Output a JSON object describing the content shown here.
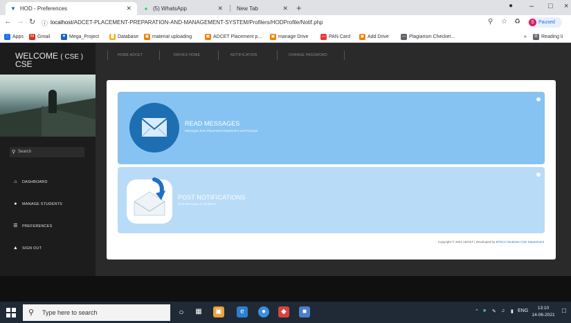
{
  "browser": {
    "tabs": [
      {
        "label": "HOD - Preferences",
        "icon": "site-favicon"
      },
      {
        "label": "(5) WhatsApp",
        "icon": "whatsapp-icon"
      },
      {
        "label": "New Tab",
        "icon": ""
      }
    ],
    "new_tab_label": "+",
    "window_controls": {
      "minimize": "–",
      "maximize": "□",
      "close": "×"
    },
    "address": {
      "host": "localhost",
      "path": "/ADCET-PLACEMENT-PREPARATION-AND-MANAGEMENT-SYSTEM/Profilers/HODProfile/Notif.php"
    },
    "profile_status": "Paused",
    "profile_initial": "S",
    "bookmarks": [
      {
        "label": "Apps",
        "color": "#1a73e8"
      },
      {
        "label": "Gmail",
        "color": "#d93025"
      },
      {
        "label": "Mega_Project",
        "color": "#1565c0"
      },
      {
        "label": "Database",
        "color": "#f9ab00"
      },
      {
        "label": "material uploading",
        "color": "#f57c00"
      },
      {
        "label": "ADCET Placement p...",
        "color": "#f57c00"
      },
      {
        "label": "manage Drive",
        "color": "#f57c00"
      },
      {
        "label": "PAN Card",
        "color": "#e53935"
      },
      {
        "label": "Add Drive",
        "color": "#f57c00"
      },
      {
        "label": "Plagiarism Checker...",
        "color": "#5f6368"
      }
    ],
    "bookmarks_overflow": "»",
    "reading_list_label": "Reading li"
  },
  "sidebar": {
    "welcome_title": "WELCOME",
    "welcome_dept": "( CSE )",
    "welcome_sub": "CSE",
    "search_placeholder": "Search",
    "items": [
      {
        "label": "DASHBOARD",
        "icon": "home-icon"
      },
      {
        "label": "MANAGE STUDENTS",
        "icon": "user-icon"
      },
      {
        "label": "PREFERENCES",
        "icon": "list-icon"
      },
      {
        "label": "SIGN OUT",
        "icon": "arrow-up-icon"
      }
    ]
  },
  "topnav": {
    "items": [
      "HOME ADCET",
      "DRIVES HOME",
      "NOTIFICATION",
      "CHANGE PASSWORD"
    ]
  },
  "cards": [
    {
      "title": "READ MESSAGES",
      "subtitle": "Messages from Placement Department and Principal",
      "icon": "envelope-icon",
      "color": "#86c3f2"
    },
    {
      "title": "POST NOTIFICATIONS",
      "subtitle": "Post Messages to Students",
      "icon": "send-mail-icon",
      "color": "#b8dbf7"
    }
  ],
  "footer": {
    "copyright_prefix": "Copyright © 2021 ADCET | Developed by ",
    "copyright_link": "BTECH Students CSE Department"
  },
  "taskbar": {
    "search_placeholder": "Type here to search",
    "tray_language": "ENG",
    "time": "13:10",
    "date": "14-06-2021"
  }
}
